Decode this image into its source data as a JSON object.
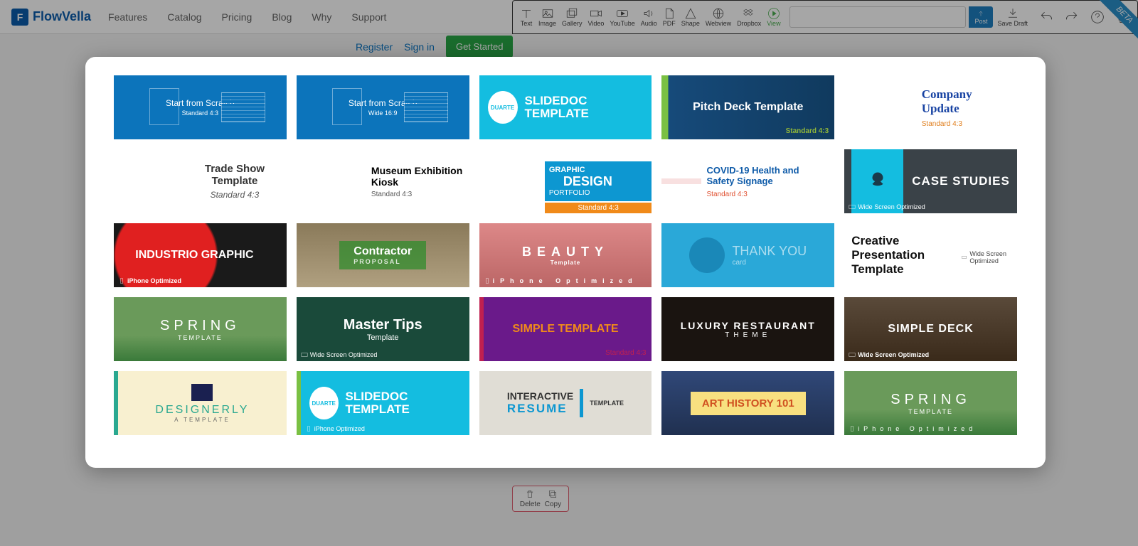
{
  "brand": "FlowVella",
  "nav": [
    "Features",
    "Catalog",
    "Pricing",
    "Blog",
    "Why",
    "Support"
  ],
  "auth": {
    "register": "Register",
    "signin": "Sign in",
    "getstarted": "Get Started"
  },
  "toolbar": {
    "tools": [
      "Text",
      "Image",
      "Gallery",
      "Video",
      "YouTube",
      "Audio",
      "PDF",
      "Shape",
      "Webview",
      "Dropbox"
    ],
    "view": "View",
    "post": "Post",
    "savedraft": "Save Draft"
  },
  "beta": "BETA",
  "slide_actions": {
    "delete": "Delete",
    "copy": "Copy"
  },
  "labels": {
    "standard43": "Standard 4:3",
    "wide169": "Wide 16:9",
    "iphone": "iPhone Optimized",
    "widescreen": "Wide Screen Optimized"
  },
  "templates": [
    {
      "title": "Start from Scratch",
      "aspect": "Standard 4:3"
    },
    {
      "title": "Start from Scratch",
      "aspect": "Wide 16:9"
    },
    {
      "badge": "DUARTE",
      "title": "SLIDEDOC TEMPLATE"
    },
    {
      "title": "Pitch Deck Template",
      "aspect": "Standard 4:3"
    },
    {
      "title": "Company Update",
      "aspect": "Standard 4:3"
    },
    {
      "title": "Trade Show Template",
      "aspect": "Standard 4:3"
    },
    {
      "title": "Museum Exhibition Kiosk",
      "aspect": "Standard 4:3"
    },
    {
      "l1": "GRAPHIC",
      "l2": "DESIGN",
      "l3": "PORTFOLIO",
      "aspect": "Standard 4:3"
    },
    {
      "title": "COVID-19 Health and Safety Signage",
      "aspect": "Standard 4:3"
    },
    {
      "title": "CASE STUDIES",
      "footer": "Wide Screen Optimized"
    },
    {
      "title": "INDUSTRIO GRAPHIC",
      "footer": "iPhone Optimized"
    },
    {
      "title": "Contractor",
      "sub": "PROPOSAL"
    },
    {
      "title": "BEAUTY",
      "sub": "Template",
      "footer": "iPhone Optimized"
    },
    {
      "title": "THANK YOU",
      "sub": "card"
    },
    {
      "title": "Creative Presentation Template",
      "footer": "Wide Screen Optimized"
    },
    {
      "title": "SPRING",
      "sub": "TEMPLATE"
    },
    {
      "title": "Master Tips",
      "sub": "Template",
      "footer": "Wide Screen Optimized"
    },
    {
      "title": "SIMPLE TEMPLATE",
      "aspect": "Standard 4:3"
    },
    {
      "title": "LUXURY RESTAURANT",
      "sub": "THEME"
    },
    {
      "title": "SIMPLE DECK",
      "footer": "Wide Screen Optimized"
    },
    {
      "title": "DESIGNERLY",
      "sub": "A TEMPLATE"
    },
    {
      "badge": "DUARTE",
      "title": "SLIDEDOC TEMPLATE",
      "footer": "iPhone Optimized"
    },
    {
      "l1": "INTERACTIVE",
      "l2": "RESUME",
      "l3": "TEMPLATE"
    },
    {
      "title": "ART HISTORY 101"
    },
    {
      "title": "SPRING",
      "sub": "TEMPLATE",
      "footer": "iPhone Optimized"
    }
  ]
}
